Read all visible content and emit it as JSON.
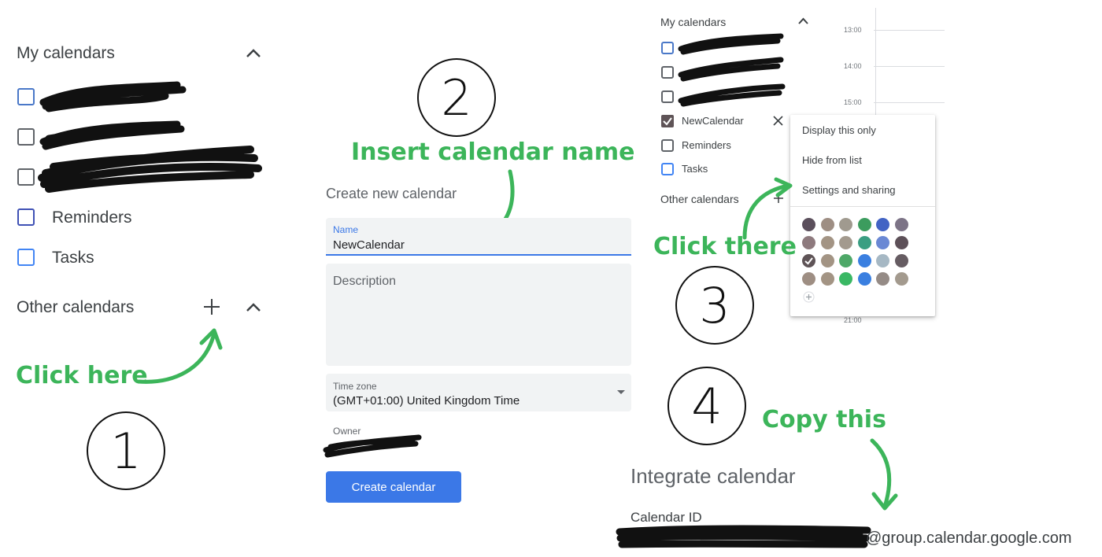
{
  "panel1": {
    "step": "1",
    "my_calendars_title": "My calendars",
    "calendars": [
      {
        "label": "",
        "color": "#4a78c8"
      },
      {
        "label": "",
        "color": "#5f5457"
      },
      {
        "label": "",
        "color": "#6a6466"
      },
      {
        "label": "Reminders",
        "color": "#3f51b5"
      },
      {
        "label": "Tasks",
        "color": "#4285f4"
      }
    ],
    "other_calendars_title": "Other calendars",
    "add_icon": "plus-icon",
    "collapse_icon": "chevron-up-icon",
    "annotation": "Click here"
  },
  "panel2": {
    "step": "2",
    "annotation": "Insert calendar name",
    "form_title": "Create new calendar",
    "name_label": "Name",
    "name_value": "NewCalendar",
    "description_placeholder": "Description",
    "timezone_label": "Time zone",
    "timezone_value": "(GMT+01:00) United Kingdom Time",
    "owner_label": "Owner",
    "create_button": "Create calendar",
    "accent": "#3b78e7"
  },
  "panel3": {
    "step": "3",
    "my_calendars_title": "My calendars",
    "calendars": [
      {
        "label": "",
        "checked": false
      },
      {
        "label": "",
        "checked": false
      },
      {
        "label": "",
        "checked": false
      },
      {
        "label": "NewCalendar",
        "checked": true
      },
      {
        "label": "Reminders",
        "checked": false
      },
      {
        "label": "Tasks",
        "checked": false
      }
    ],
    "other_calendars_title": "Other calendars",
    "times": [
      "13:00",
      "14:00",
      "15:00",
      "21:00"
    ],
    "menu": [
      "Display this only",
      "Hide from list",
      "Settings and sharing"
    ],
    "swatch_colors": [
      [
        "#5b4f5c",
        "#9e8e83",
        "#a09a8f",
        "#3c9c5e",
        "#4263c4",
        "#7c7386"
      ],
      [
        "#8e7a7e",
        "#a39484",
        "#a39a8e",
        "#3a9e82",
        "#6a88d4",
        "#5d5058"
      ],
      [
        "#5f5457",
        "#a39484",
        "#4ea868",
        "#3a7fe0",
        "#a6b8c4",
        "#665c62"
      ],
      [
        "#9e8e83",
        "#a39484",
        "#3ab864",
        "#3a7fe0",
        "#958b86",
        "#a39a8e"
      ]
    ],
    "annotation": "Click there"
  },
  "panel4": {
    "step": "4",
    "annotation": "Copy this",
    "title": "Integrate calendar",
    "calendar_id_label": "Calendar ID",
    "calendar_id_suffix": "@group.calendar.google.com"
  }
}
